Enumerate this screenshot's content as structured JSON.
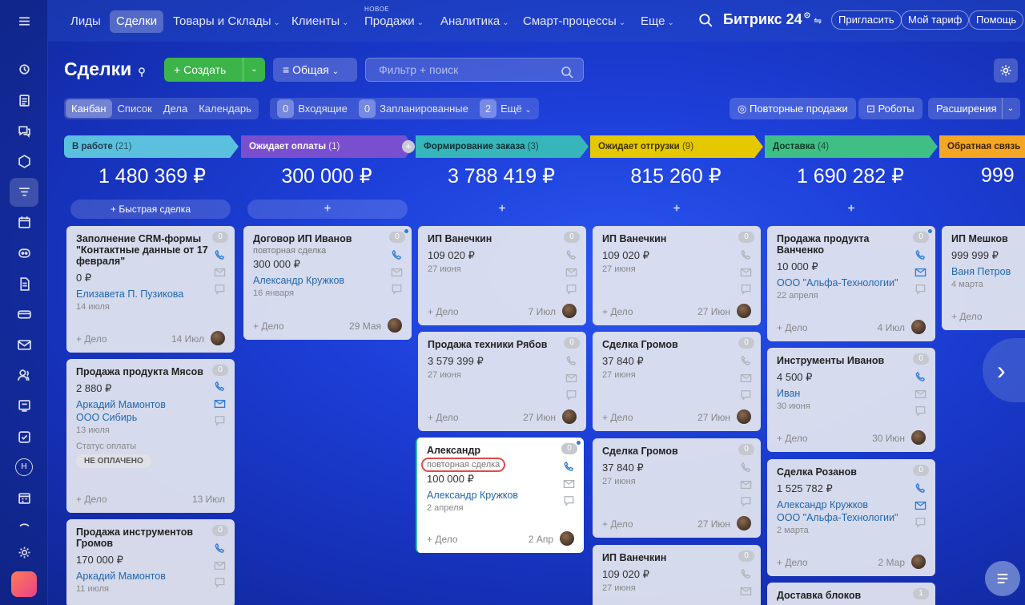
{
  "topnav": {
    "items": [
      "Лиды",
      "Сделки",
      "Товары и Склады",
      "Клиенты",
      "Продажи",
      "Аналитика",
      "Смарт-процессы",
      "Еще"
    ],
    "new_tag": "НОВОЕ",
    "brand": "Битрикс 24",
    "invite": "Пригласить",
    "tariff": "Мой тариф",
    "help": "Помощь"
  },
  "page": {
    "title": "Сделки",
    "create": "Создать",
    "general": "Общая",
    "search_placeholder": "Фильтр + поиск"
  },
  "views": [
    "Канбан",
    "Список",
    "Дела",
    "Календарь"
  ],
  "counters": {
    "incoming_n": "0",
    "incoming": "Входящие",
    "planned_n": "0",
    "planned": "Запланированные",
    "more_n": "2",
    "more": "Ещё"
  },
  "actions": {
    "repeat": "Повторные продажи",
    "robots": "Роботы",
    "ext": "Расширения"
  },
  "stages": [
    {
      "name": "В работе",
      "count": "(21)",
      "sum": "1 480 369 ₽",
      "add": "Быстрая сделка",
      "color": "#5bc0de"
    },
    {
      "name": "Ожидает оплаты",
      "count": "(1)",
      "sum": "300 000 ₽",
      "add": "+",
      "color": "#7a4fcf"
    },
    {
      "name": "Формирование заказа",
      "count": "(3)",
      "sum": "3 788 419 ₽",
      "add": "+",
      "color": "#36b6bb"
    },
    {
      "name": "Ожидает отгрузки",
      "count": "(9)",
      "sum": "815 260 ₽",
      "add": "+",
      "color": "#e6c800"
    },
    {
      "name": "Доставка",
      "count": "(4)",
      "sum": "1 690 282 ₽",
      "add": "+",
      "color": "#3fbf86"
    },
    {
      "name": "Обратная связь",
      "count": "",
      "sum": "999",
      "add": "",
      "color": "#f5a623"
    }
  ],
  "cards": {
    "c1": {
      "title": "Заполнение CRM-формы \"Контактные данные от 17 февраля\"",
      "price": "0 ₽",
      "contact": "Елизавета П. Пузикова",
      "date": "14 июля",
      "deal": "+ Дело",
      "fdate": "14 Июл",
      "cnt": "0"
    },
    "c2": {
      "title": "Продажа продукта Мясов",
      "price": "2 880 ₽",
      "contact": "Аркадий Мамонтов",
      "company": "ООО Сибирь",
      "date": "13 июля",
      "status_label": "Статус оплаты",
      "status": "НЕ ОПЛАЧЕНО",
      "deal": "+ Дело",
      "fdate": "13 Июл",
      "cnt": "0"
    },
    "c3": {
      "title": "Продажа инструментов Громов",
      "price": "170 000 ₽",
      "contact": "Аркадий Мамонтов",
      "date": "11 июля",
      "cnt": "0"
    },
    "c4": {
      "title": "Договор ИП Иванов",
      "sub": "повторная сделка",
      "price": "300 000 ₽",
      "contact": "Александр Кружков",
      "date": "16 января",
      "deal": "+ Дело",
      "fdate": "29 Мая",
      "cnt": "0"
    },
    "c5": {
      "title": "ИП Ванечкин",
      "price": "109 020 ₽",
      "date": "27 июня",
      "deal": "+ Дело",
      "fdate": "7 Июл",
      "cnt": "0"
    },
    "c6": {
      "title": "Продажа техники Рябов",
      "price": "3 579 399 ₽",
      "date": "27 июня",
      "deal": "+ Дело",
      "fdate": "27 Июн",
      "cnt": "0"
    },
    "c7": {
      "title": "Александр",
      "sub": "повторная сделка",
      "price": "100 000 ₽",
      "contact": "Александр Кружков",
      "date": "2 апреля",
      "deal": "+ Дело",
      "fdate": "2 Апр",
      "cnt": "0"
    },
    "c8": {
      "title": "ИП Ванечкин",
      "price": "109 020 ₽",
      "date": "27 июня",
      "deal": "+ Дело",
      "fdate": "27 Июн",
      "cnt": "0"
    },
    "c9": {
      "title": "Сделка Громов",
      "price": "37 840 ₽",
      "date": "27 июня",
      "deal": "+ Дело",
      "fdate": "27 Июн",
      "cnt": "0"
    },
    "c10": {
      "title": "Сделка Громов",
      "price": "37 840 ₽",
      "date": "27 июня",
      "deal": "+ Дело",
      "fdate": "27 Июн",
      "cnt": "0"
    },
    "c11": {
      "title": "ИП Ванечкин",
      "price": "109 020 ₽",
      "date": "27 июня",
      "cnt": "0"
    },
    "c12": {
      "title": "Продажа продукта Ванченко",
      "price": "10 000 ₽",
      "contact": "ООО \"Альфа-Технологии\"",
      "date": "22 апреля",
      "deal": "+ Дело",
      "fdate": "4 Июл",
      "cnt": "0"
    },
    "c13": {
      "title": "Инструменты Иванов",
      "price": "4 500 ₽",
      "contact": "Иван",
      "date": "30 июня",
      "deal": "+ Дело",
      "fdate": "30 Июн",
      "cnt": "0"
    },
    "c14": {
      "title": "Сделка Розанов",
      "price": "1 525 782 ₽",
      "contact": "Александр Кружков",
      "company": "ООО \"Альфа-Технологии\"",
      "date": "2 марта",
      "deal": "+ Дело",
      "fdate": "2 Мар",
      "cnt": "0"
    },
    "c15": {
      "title": "Доставка блоков",
      "cnt": "1"
    },
    "c16": {
      "title": "ИП Мешков",
      "price": "999 999 ₽",
      "contact": "Ваня Петров",
      "date": "4 марта",
      "deal": "+ Дело"
    }
  }
}
